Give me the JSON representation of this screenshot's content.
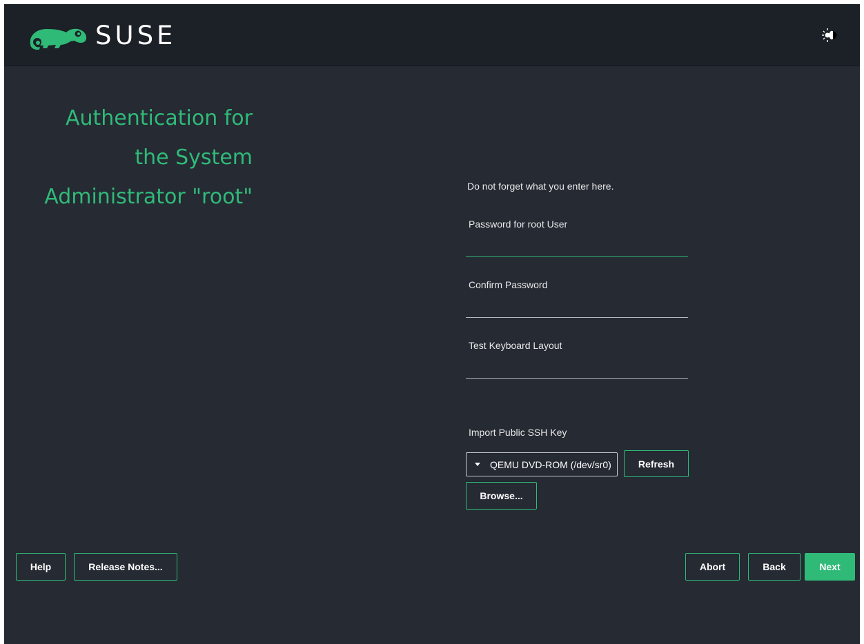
{
  "header": {
    "brand": "SUSE",
    "icons": {
      "logo": "suse-chameleon-logo-icon",
      "theme": "theme-toggle-icon"
    },
    "colors": {
      "brand_green": "#30ba78",
      "header_bg": "#1c2027",
      "content_bg": "#252a33"
    }
  },
  "title": {
    "lines": [
      "Authentication for",
      "the System",
      "Administrator \"root\""
    ]
  },
  "form": {
    "hint": "Do not forget what you enter here.",
    "password_label": "Password for root User",
    "password_value": "",
    "confirm_label": "Confirm Password",
    "confirm_value": "",
    "keyboard_label": "Test Keyboard Layout",
    "keyboard_value": "",
    "ssh_label": "Import Public SSH Key",
    "ssh_device": "QEMU DVD-ROM (/dev/sr0)",
    "refresh_label": "Refresh",
    "browse_label": "Browse..."
  },
  "footer": {
    "help_label": "Help",
    "release_notes_label": "Release Notes...",
    "abort_label": "Abort",
    "back_label": "Back",
    "next_label": "Next"
  }
}
